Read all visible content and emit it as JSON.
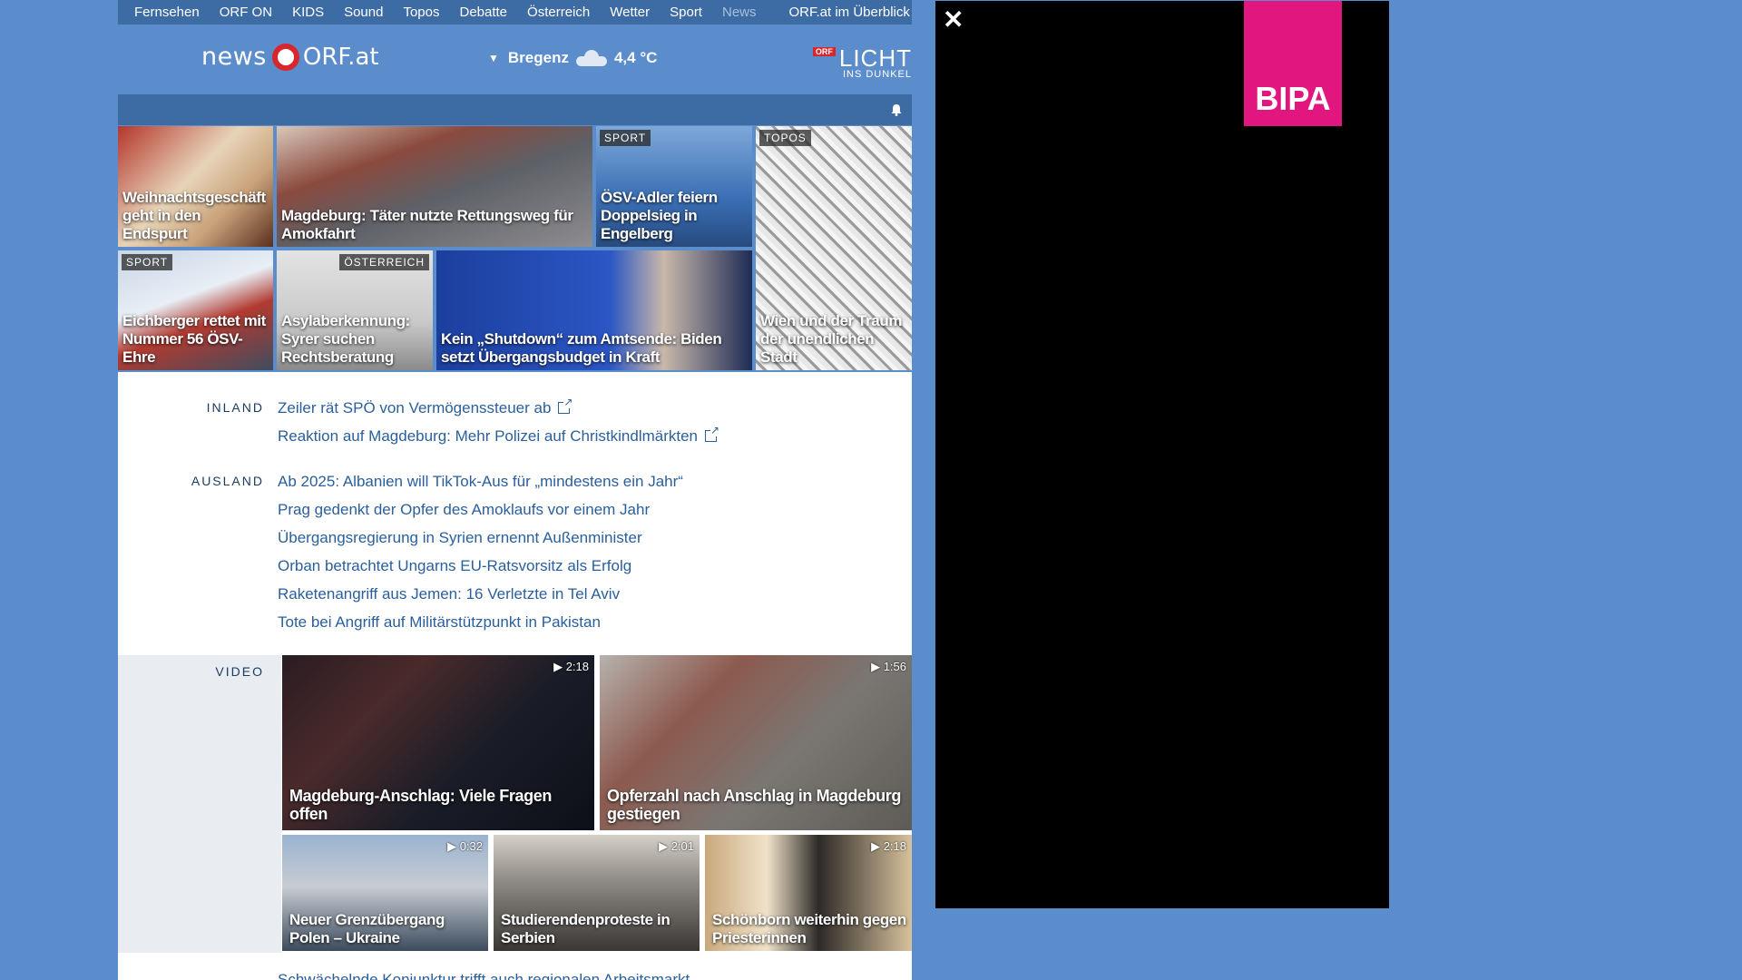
{
  "topnav": {
    "items": [
      "Fernsehen",
      "ORF ON",
      "KIDS",
      "Sound",
      "Topos",
      "Debatte",
      "Österreich",
      "Wetter",
      "Sport",
      "News"
    ],
    "overview": "ORF.at im Überblick"
  },
  "header": {
    "logo_news": "news",
    "logo_orf": "ORF.at",
    "weather_city": "Bregenz",
    "weather_temp": "4,4 °C",
    "licht_badge": "ORF",
    "licht_big": "LICHT",
    "licht_small": "INS DUNKEL"
  },
  "tiles": [
    {
      "label": "Weihnachtsgeschäft geht in den Endspurt",
      "tag": ""
    },
    {
      "label": "Magdeburg: Täter nutzte Rettungsweg für Amokfahrt",
      "tag": ""
    },
    {
      "label": "ÖSV-Adler feiern Doppelsieg in Engelberg",
      "tag": "SPORT"
    },
    {
      "label": "Wien und der Traum der unendlichen Stadt",
      "tag": "TOPOS"
    },
    {
      "label": "Eichberger rettet mit Nummer 56 ÖSV-Ehre",
      "tag": "SPORT"
    },
    {
      "label": "Asylaberkennung: Syrer suchen Rechtsberatung",
      "tag": "ÖSTERREICH"
    },
    {
      "label": "Kein „Shutdown“ zum Amtsende: Biden setzt Übergangsbudget in Kraft",
      "tag": ""
    }
  ],
  "inland": {
    "category": "INLAND",
    "links": [
      "Zeiler rät SPÖ von Vermögenssteuer ab",
      "Reaktion auf Magdeburg: Mehr Polizei auf Christkindlmärkten"
    ]
  },
  "ausland": {
    "category": "AUSLAND",
    "links": [
      "Ab 2025: Albanien will TikTok-Aus für „mindestens ein Jahr“",
      "Prag gedenkt der Opfer des Amoklaufs vor einem Jahr",
      "Übergangsregierung in Syrien ernennt Außenminister",
      "Orban betrachtet Ungarns EU-Ratsvorsitz als Erfolg",
      "Raketenangriff aus Jemen: 16 Verletzte in Tel Aviv",
      "Tote bei Angriff auf Militärstützpunkt in Pakistan"
    ]
  },
  "video": {
    "category": "VIDEO",
    "items": [
      {
        "label": "Magdeburg-Anschlag: Viele Fragen offen",
        "duration": "2:18"
      },
      {
        "label": "Opferzahl nach Anschlag in Magdeburg gestiegen",
        "duration": "1:56"
      },
      {
        "label": "Neuer Grenzübergang Polen – Ukraine",
        "duration": "0:32"
      },
      {
        "label": "Studierendenproteste in Serbien",
        "duration": "2:01"
      },
      {
        "label": "Schönborn weiterhin gegen Priesterinnen",
        "duration": "2:18"
      }
    ]
  },
  "bottom_link": "Schwächelnde Konjunktur trifft auch regionalen Arbeitsmarkt",
  "ad": {
    "brand": "BIPA",
    "close": "✕"
  }
}
